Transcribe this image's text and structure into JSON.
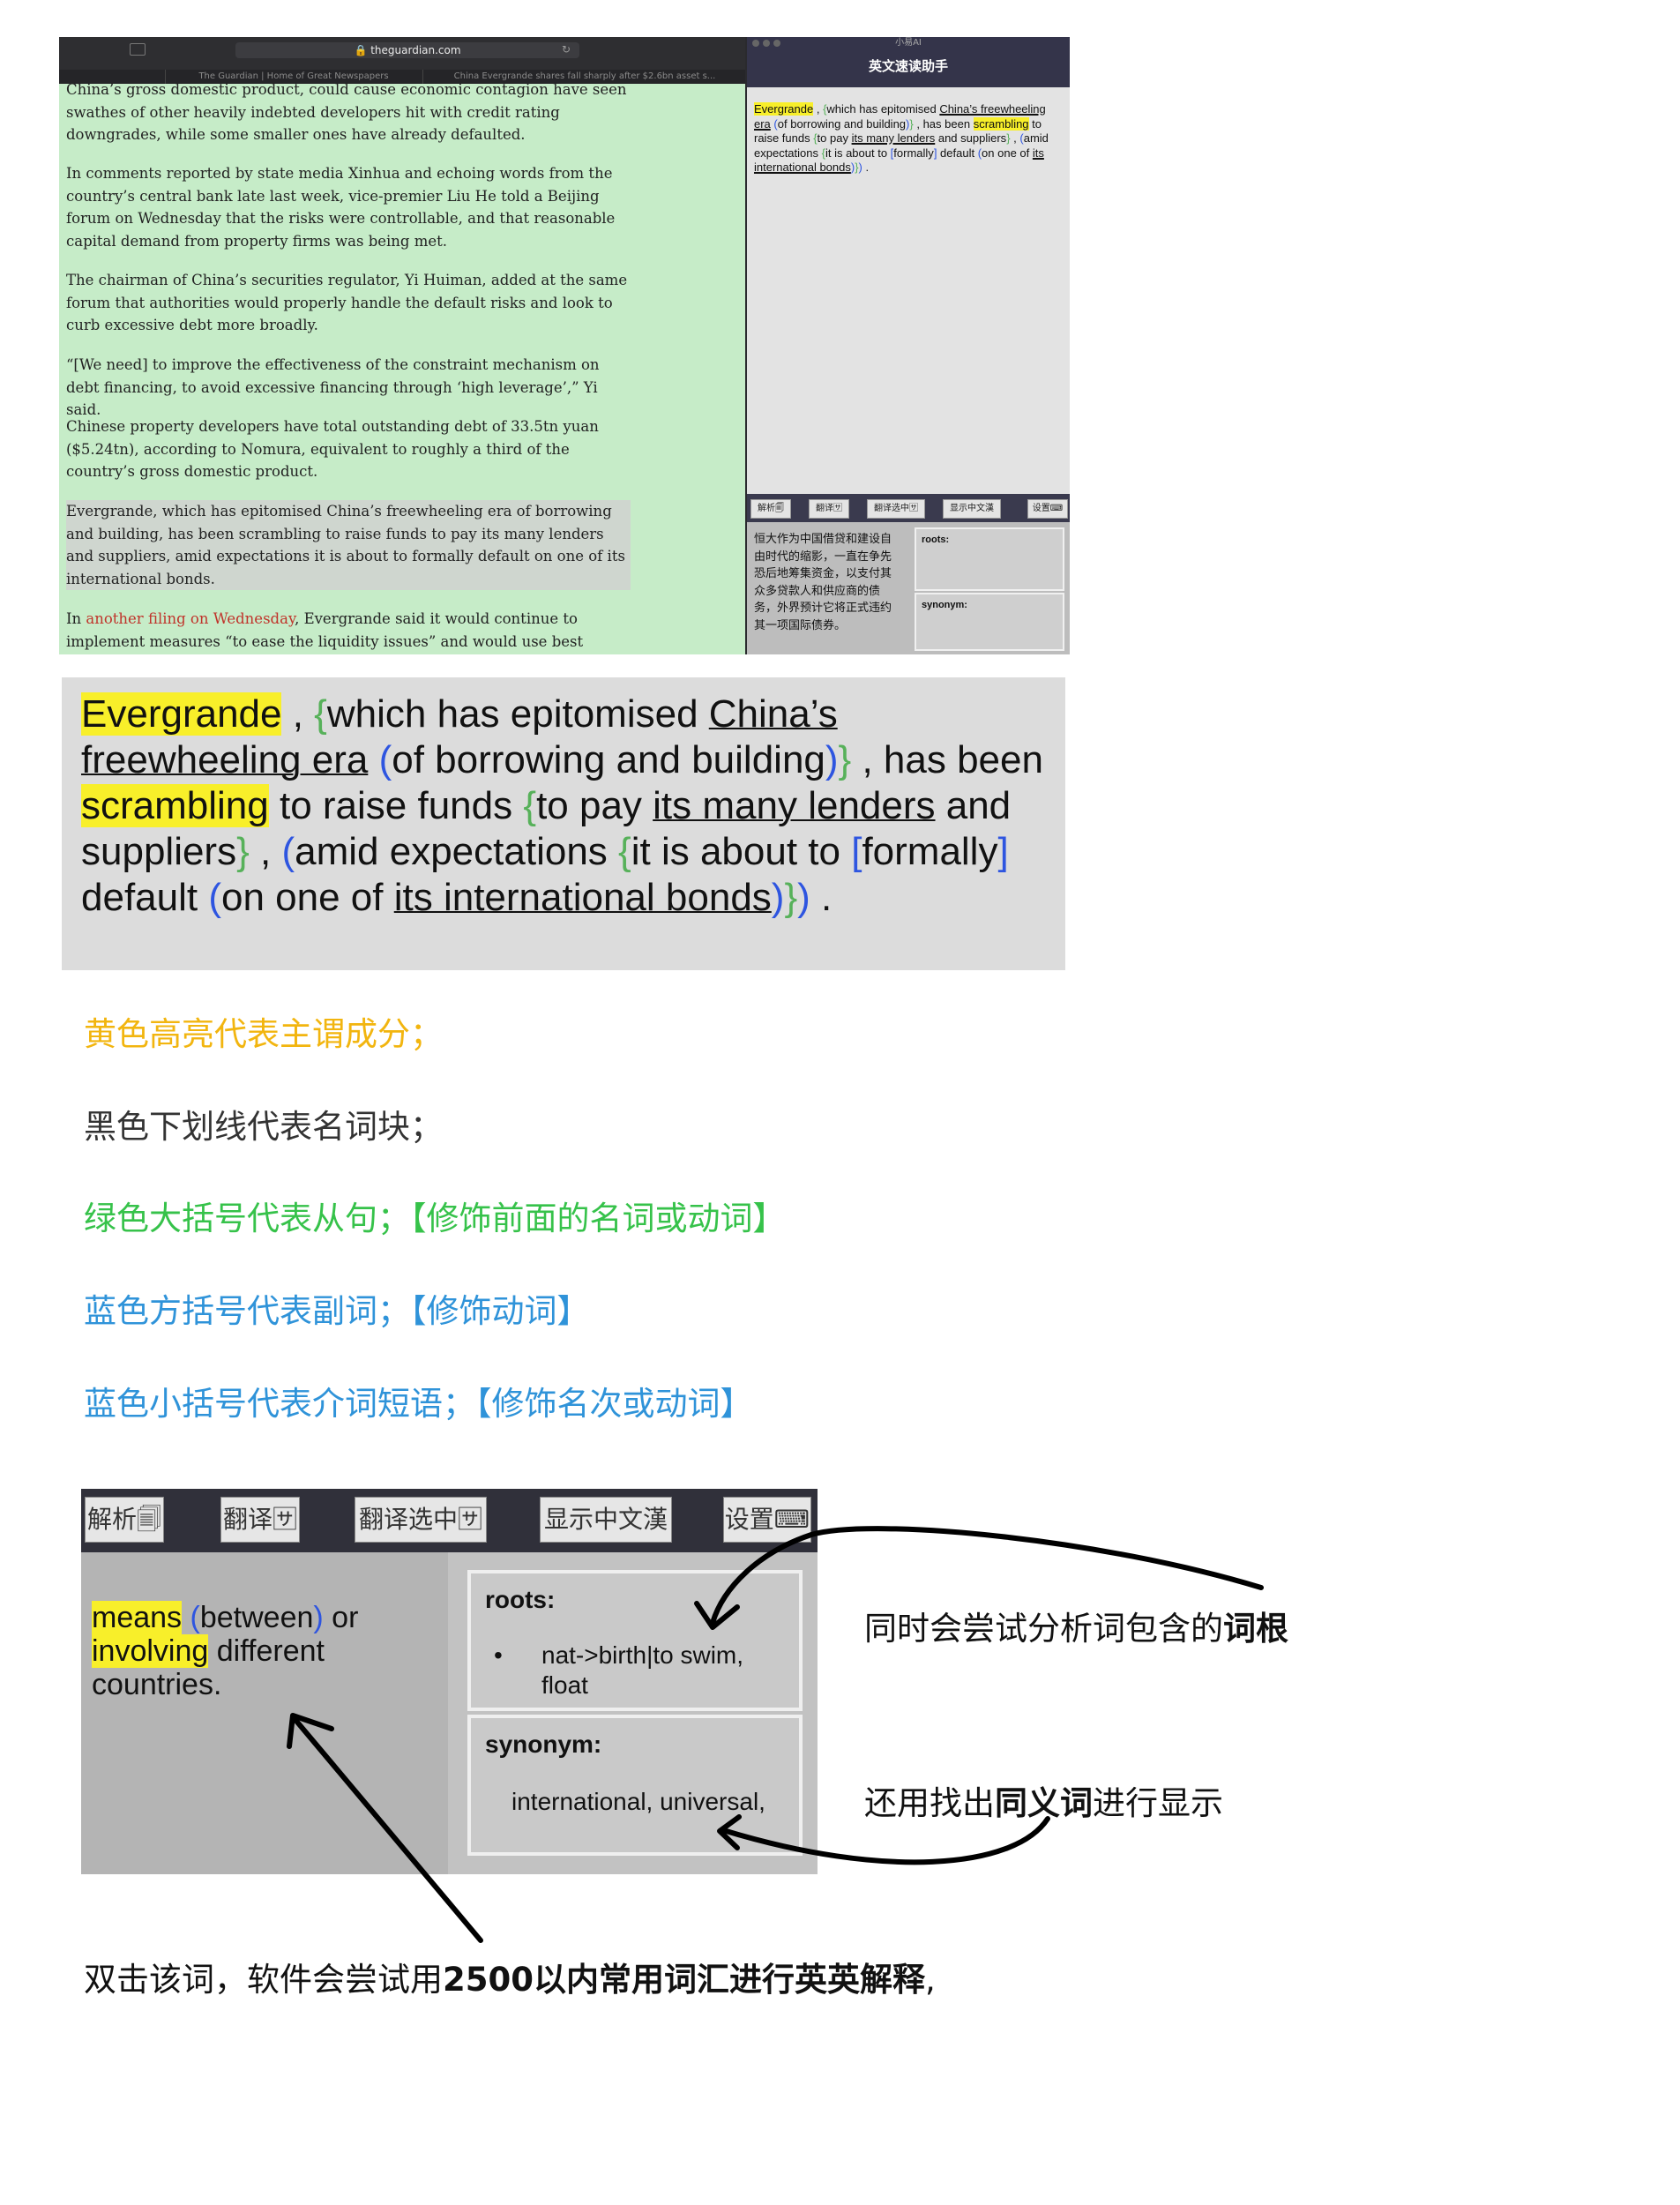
{
  "browser": {
    "url": "theguardian.com",
    "tabs": [
      "The Guardian | Home of Great Newspapers",
      "China Evergrande shares fall sharply after $2.6bn asset s..."
    ]
  },
  "article": {
    "paragraphs": [
      "China’s gross domestic product, could cause economic contagion have seen swathes of other heavily indebted developers hit with credit rating downgrades, while some smaller ones have already defaulted.",
      "In comments reported by state media Xinhua and echoing words from the country’s central bank late last week, vice-premier Liu He told a Beijing forum on Wednesday that the risks were controllable, and that reasonable capital demand from property firms was being met.",
      "The chairman of China’s securities regulator, Yi Huiman, added at the same forum that authorities would properly handle the default risks and look to curb excessive debt more broadly.",
      "“[We need] to improve the effectiveness of the constraint mechanism on debt financing, to avoid excessive financing through ‘high leverage’,” Yi said.",
      "Chinese property developers have total outstanding debt of 33.5tn yuan ($5.24tn), according to Nomura, equivalent to roughly a third of the country’s gross domestic product.",
      "Evergrande, which has epitomised China’s freewheeling era of borrowing and building, has been scrambling to raise funds to pay its many lenders and suppliers, amid expectations it is about to formally default on one of its international bonds."
    ],
    "last_para": {
      "prefix": "In ",
      "link": "another filing on Wednesday",
      "rest": ", Evergrande said it would continue to implement measures “to ease the liquidity issues” and would use best efforts to negotiate for the renewal or extension of its borrowings with its creditors."
    }
  },
  "app": {
    "name": "小易AI",
    "title": "英文速读助手",
    "toolbar": [
      "解析🗐",
      "翻译🈂",
      "翻译选中🈂",
      "显示中文漢",
      "设置⌨"
    ],
    "translation": "恒大作为中国借贷和建设自由时代的缩影，一直在争先恐后地筹集资金，以支付其众多贷款人和供应商的债务，外界预计它将正式违约其一项国际债券。",
    "roots_label": "roots:",
    "synonym_label": "synonym:"
  },
  "sentence": {
    "parts": [
      {
        "t": "Evergrande",
        "c": "y"
      },
      {
        "t": " , ",
        "c": ""
      },
      {
        "t": "{",
        "c": "g"
      },
      {
        "t": "which has epitomised ",
        "c": ""
      },
      {
        "t": "China’s freewheeling era",
        "c": "u"
      },
      {
        "t": " ",
        "c": ""
      },
      {
        "t": "(",
        "c": "b"
      },
      {
        "t": "of borrowing and building",
        "c": ""
      },
      {
        "t": ")",
        "c": "b"
      },
      {
        "t": "}",
        "c": "g"
      },
      {
        "t": " , has been ",
        "c": ""
      },
      {
        "t": "scrambling",
        "c": "y"
      },
      {
        "t": " to raise funds ",
        "c": ""
      },
      {
        "t": "{",
        "c": "g"
      },
      {
        "t": "to pay ",
        "c": ""
      },
      {
        "t": "its many lenders",
        "c": "u"
      },
      {
        "t": " and suppliers",
        "c": ""
      },
      {
        "t": "}",
        "c": "g"
      },
      {
        "t": " , ",
        "c": ""
      },
      {
        "t": "(",
        "c": "b"
      },
      {
        "t": "amid expectations ",
        "c": ""
      },
      {
        "t": "{",
        "c": "g"
      },
      {
        "t": "it is about to ",
        "c": ""
      },
      {
        "t": "[",
        "c": "b"
      },
      {
        "t": "formally",
        "c": ""
      },
      {
        "t": "]",
        "c": "b"
      },
      {
        "t": " default ",
        "c": ""
      },
      {
        "t": "(",
        "c": "b"
      },
      {
        "t": "on one of ",
        "c": ""
      },
      {
        "t": "its international bonds",
        "c": "u"
      },
      {
        "t": ")",
        "c": "b"
      },
      {
        "t": "}",
        "c": "g"
      },
      {
        "t": ")",
        "c": "b"
      },
      {
        "t": " .",
        "c": ""
      }
    ]
  },
  "legend": {
    "items": [
      {
        "text": "黄色高亮代表主谓成分；",
        "color": "#f2b50f"
      },
      {
        "text": "黑色下划线代表名词块；",
        "color": "#333333"
      },
      {
        "text": "绿色大括号代表从句；【修饰前面的名词或动词】",
        "color": "#36c24a"
      },
      {
        "text": "蓝色方括号代表副词；【修饰动词】",
        "color": "#2f93d9"
      },
      {
        "text": "蓝色小括号代表介词短语；【修饰名次或动词】",
        "color": "#2f93d9"
      }
    ]
  },
  "panel": {
    "toolbar": [
      "解析🗐",
      "翻译🈂",
      "翻译选中🈂",
      "显示中文漢",
      "设置⌨"
    ],
    "definition": [
      {
        "t": "means",
        "c": "y"
      },
      {
        "t": " ",
        "c": ""
      },
      {
        "t": "(",
        "c": "b"
      },
      {
        "t": "between",
        "c": ""
      },
      {
        "t": ")",
        "c": "b"
      },
      {
        "t": " or ",
        "c": ""
      },
      {
        "t": "involving",
        "c": "y"
      },
      {
        "t": " different countries.",
        "c": ""
      }
    ],
    "roots_label": "roots:",
    "roots_item": "nat->birth|to swim, float",
    "synonym_label": "synonym:",
    "synonym_text": "international, universal,"
  },
  "callouts": {
    "roots_prefix": "同时会尝试分析词包含的",
    "roots_bold": "词根",
    "syn_prefix": "还用找出",
    "syn_bold": "同义词",
    "syn_suffix": "进行显示",
    "dbl_prefix": "双击该词，软件会尝试用",
    "dbl_bold": "2500以内常用词汇进行英英解释",
    "dbl_suffix": ","
  }
}
